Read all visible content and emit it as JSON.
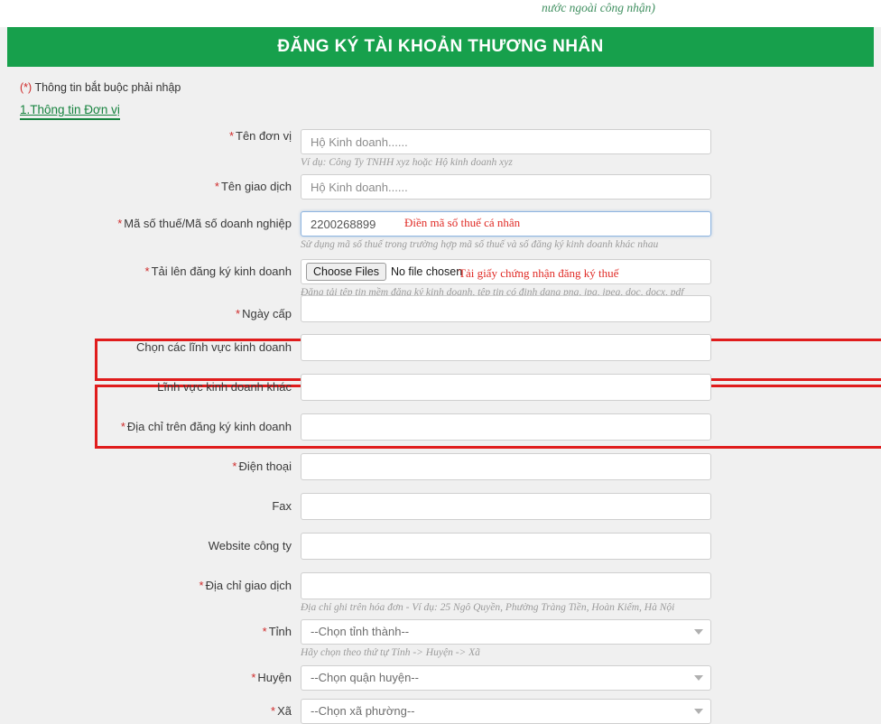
{
  "top_note": "nước ngoài công nhận)",
  "banner": {
    "title": "ĐĂNG KÝ TÀI KHOẢN THƯƠNG NHÂN",
    "color": "#17a04c"
  },
  "notes": {
    "required_marker": "(*)",
    "required_text": " Thông tin bắt buộc phải nhập",
    "section_title": "1.Thông tin Đơn vị",
    "section_color": "#17833f"
  },
  "annotation_color": "#e01c1c",
  "fields": {
    "ten_don_vi": {
      "label": "Tên đơn vị",
      "required": true,
      "placeholder": "Hộ Kinh doanh......",
      "value": "",
      "hint": "Ví dụ: Công Ty TNHH xyz hoặc Hộ kinh doanh xyz"
    },
    "ten_giao_dich": {
      "label": "Tên giao dịch",
      "required": true,
      "placeholder": "Hộ Kinh doanh......",
      "value": "",
      "hint": ""
    },
    "ma_so_thue": {
      "label": "Mã số thuế/Mã số doanh nghiệp",
      "required": true,
      "placeholder": "",
      "value": "2200268899",
      "annotation": "Điền mã số thuế cá nhân",
      "hint": "Sử dụng mã số thuế trong trường hợp mã số thuế và số đăng ký kinh doanh khác nhau"
    },
    "tai_len_dkkd": {
      "label": "Tải lên đăng ký kinh doanh",
      "required": true,
      "choose_button": "Choose Files",
      "file_status": "No file chosen",
      "annotation": "Tải giấy chứng nhận đăng ký thuế",
      "hint": "Đăng tải tệp tin mềm đăng ký kinh doanh, tệp tin có định dạng png, jpg, jpeg, doc, docx, pdf"
    },
    "ngay_cap": {
      "label": "Ngày cấp",
      "required": true,
      "placeholder": "",
      "value": "",
      "hint": ""
    },
    "linh_vuc_kinh_doanh": {
      "label": "Chọn các lĩnh vực kinh doanh",
      "required": false,
      "placeholder": "",
      "value": "",
      "hint": ""
    },
    "linh_vuc_khac": {
      "label": "Lĩnh vực kinh doanh khác",
      "required": false,
      "placeholder": "",
      "value": "",
      "hint": ""
    },
    "dia_chi_dkkd": {
      "label": "Địa chỉ trên đăng ký kinh doanh",
      "required": true,
      "placeholder": "",
      "value": "",
      "hint": ""
    },
    "dien_thoai": {
      "label": "Điện thoại",
      "required": true,
      "placeholder": "",
      "value": "",
      "hint": ""
    },
    "fax": {
      "label": "Fax",
      "required": false,
      "placeholder": "",
      "value": "",
      "hint": ""
    },
    "website": {
      "label": "Website công ty",
      "required": false,
      "placeholder": "",
      "value": "",
      "hint": ""
    },
    "dia_chi_giao_dich": {
      "label": "Địa chỉ giao dịch",
      "required": true,
      "placeholder": "",
      "value": "",
      "hint": "Địa chỉ ghi trên hóa đơn - Ví dụ: 25 Ngô Quyền, Phường Tràng Tiền, Hoàn Kiếm, Hà Nội"
    },
    "tinh": {
      "label": "Tỉnh",
      "required": true,
      "selected": "--Chọn tỉnh thành--",
      "hint": "Hãy chọn theo thứ tự Tỉnh -> Huyện -> Xã"
    },
    "huyen": {
      "label": "Huyện",
      "required": true,
      "selected": "--Chọn quận huyện--",
      "hint": ""
    },
    "xa": {
      "label": "Xã",
      "required": true,
      "selected": "--Chọn xã phường--",
      "hint": ""
    }
  }
}
